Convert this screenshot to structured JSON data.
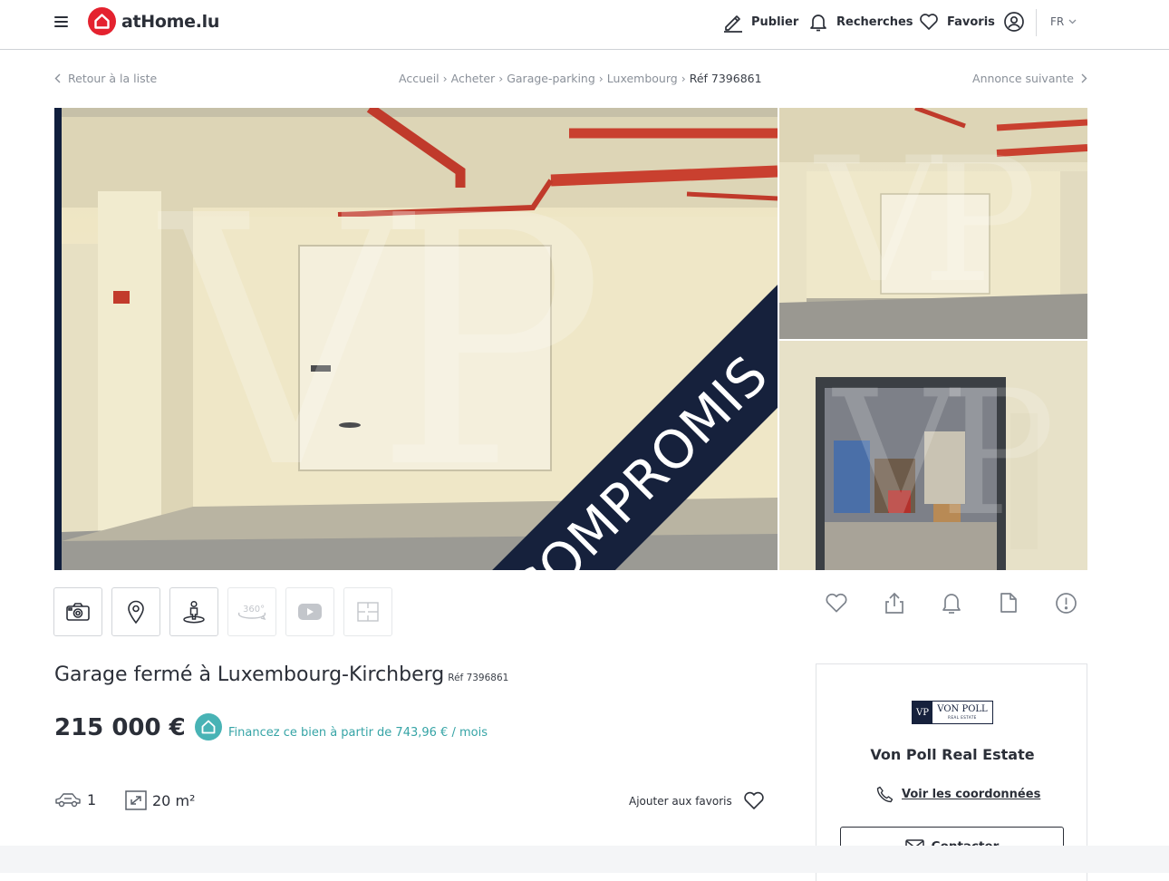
{
  "header": {
    "logo_text": "atHome.lu",
    "nav": {
      "publish": "Publier",
      "searches": "Recherches",
      "favorites": "Favoris"
    },
    "lang": "FR"
  },
  "navrow": {
    "back": "Retour à la liste",
    "next": "Annonce suivante",
    "breadcrumb": [
      "Accueil",
      "Acheter",
      "Garage-parking",
      "Luxembourg",
      "Réf 7396861"
    ]
  },
  "gallery": {
    "banner": "COMPROMIS",
    "watermark": "VP",
    "tiles": [
      "camera-icon",
      "map-pin-icon",
      "street-view-icon",
      "360-icon",
      "video-icon",
      "floorplan-icon"
    ],
    "tile_360_label": "360°"
  },
  "listing": {
    "title": "Garage fermé à Luxembourg-Kirchberg",
    "ref": "Réf 7396861",
    "price": "215 000 €",
    "financing": "Financez ce bien à partir de 743,96 € / mois",
    "parking_count": "1",
    "surface": "20 m²",
    "add_favorite": "Ajouter aux favoris"
  },
  "agent": {
    "logo_mark": "VP",
    "logo_text": "VON POLL",
    "logo_sub": "REAL ESTATE",
    "name": "Von Poll Real Estate",
    "view_contact": "Voir les coordonnées",
    "contact_button": "Contacter"
  },
  "colors": {
    "brand": "#e4222f",
    "teal": "#48b3b5",
    "navy": "#16213c",
    "text": "#2b2f38"
  }
}
